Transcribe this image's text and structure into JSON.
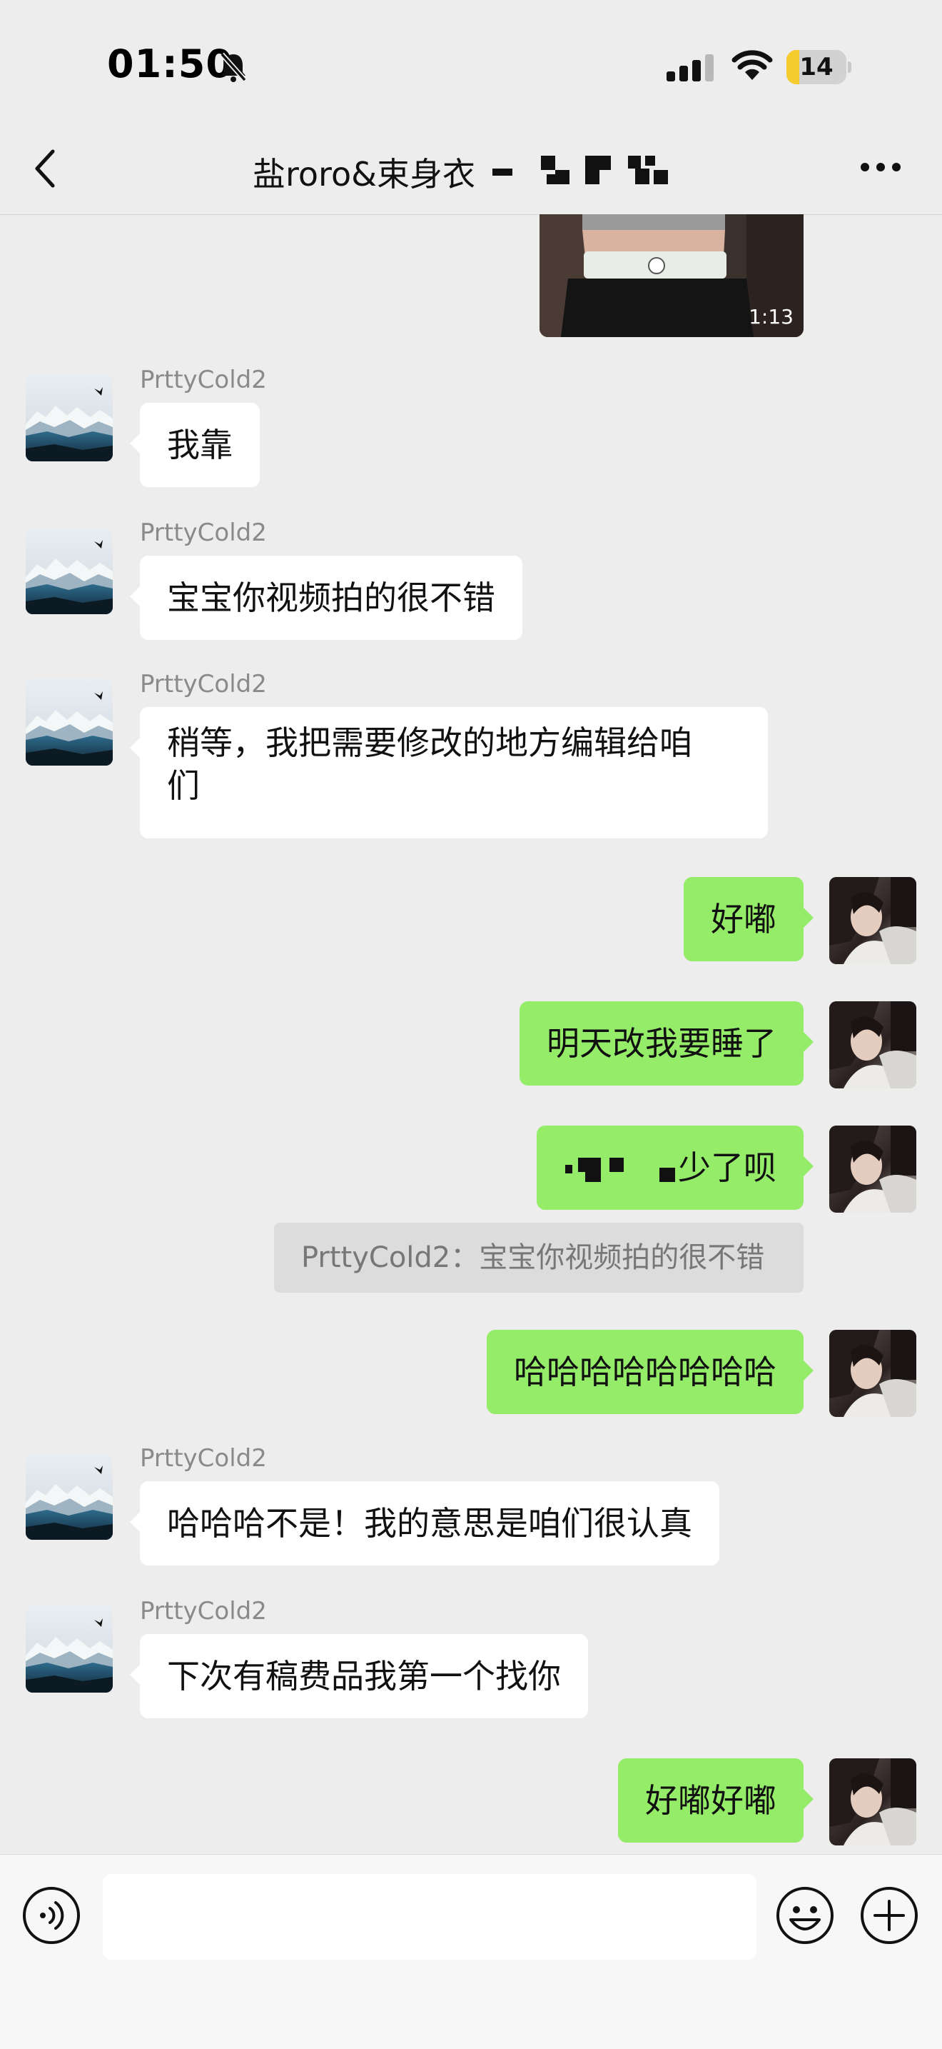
{
  "status_bar": {
    "time": "01:50",
    "battery": "14",
    "icons": [
      "bell-off-icon",
      "signal-icon",
      "wifi-icon",
      "battery-icon"
    ]
  },
  "nav": {
    "title": "盐roro&束身衣",
    "icons": [
      "back-icon",
      "more-icon"
    ]
  },
  "video": {
    "duration": "1:13"
  },
  "messages": [
    {
      "sender": "PrttyCold2",
      "text": "我靠"
    },
    {
      "sender": "PrttyCold2",
      "text": "宝宝你视频拍的很不错"
    },
    {
      "sender": "PrttyCold2",
      "text_line1": "稍等，我把需要修改的地方编辑给咱",
      "text_line2": "们"
    },
    {
      "text": "好嘟"
    },
    {
      "text": "明天改我要睡了"
    },
    {
      "text": "少了呗"
    },
    {
      "quote": "PrttyCold2：宝宝你视频拍的很不错"
    },
    {
      "text": "哈哈哈哈哈哈哈哈"
    },
    {
      "sender": "PrttyCold2",
      "text": "哈哈哈不是！我的意思是咱们很认真"
    },
    {
      "sender": "PrttyCold2",
      "text": "下次有稿费品我第一个找你"
    },
    {
      "text": "好嘟好嘟"
    }
  ],
  "input_bar": {
    "message_value": "",
    "icons": [
      "voice-icon",
      "emoji-icon",
      "plus-icon"
    ]
  },
  "colors": {
    "outgoing_bubble": "#95ec69",
    "incoming_bubble": "#ffffff",
    "background": "#ededed"
  }
}
